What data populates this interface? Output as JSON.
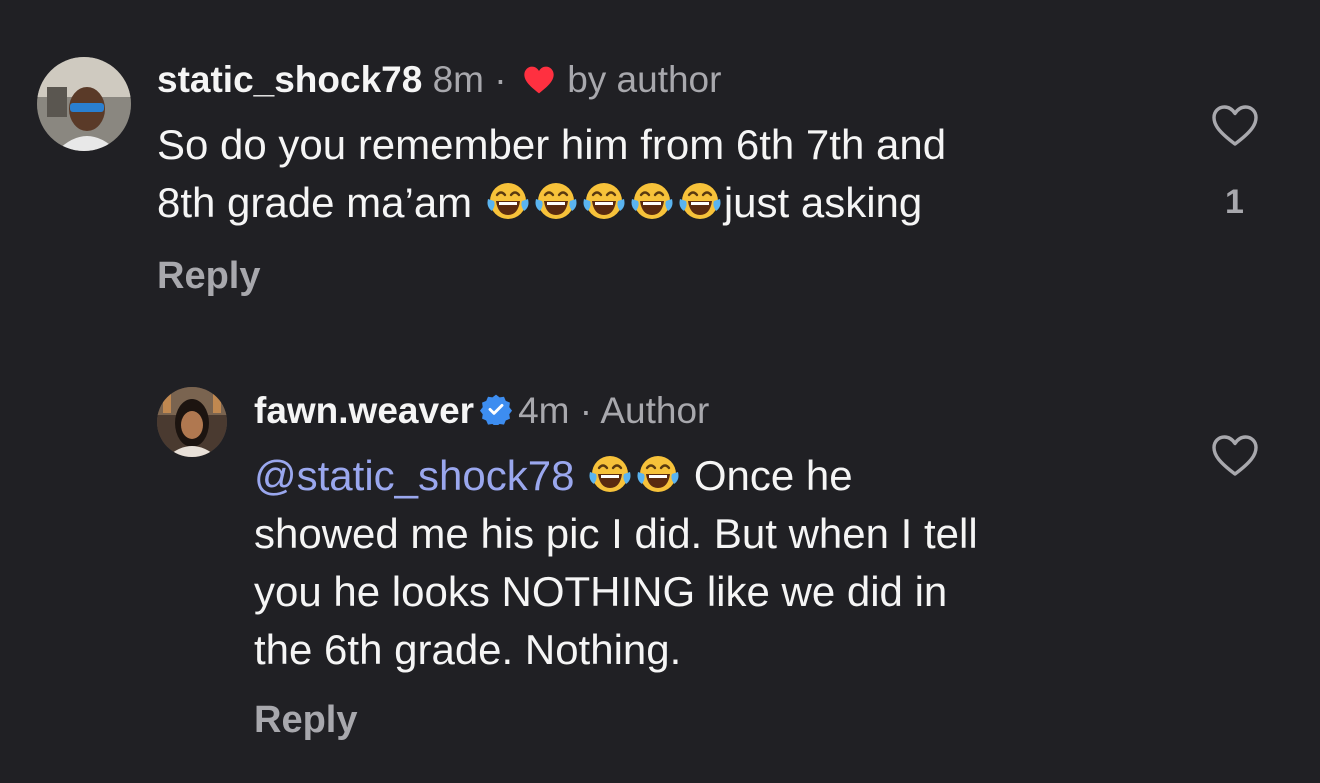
{
  "comments": [
    {
      "username": "static_shock78",
      "time": "8m",
      "separator": "·",
      "by_author": "by author",
      "text_1": "So do you remember him from 6th 7th and",
      "text_2a": "8th grade ma’am",
      "emoji_count": 5,
      "text_2b": "just asking",
      "reply_label": "Reply",
      "like_count": "1",
      "icons": [
        "avatar",
        "heart-filled-icon",
        "heart-outline-icon",
        "face-with-tears-of-joy-emoji"
      ]
    },
    {
      "username": "fawn.weaver",
      "time": "4m",
      "separator": "·",
      "author_label": "Author",
      "mention": "@static_shock78",
      "text_after_emoji": "Once he",
      "text_line_2": "showed me his pic I did. But when I tell",
      "text_line_3": "you he looks NOTHING like we did in",
      "text_line_4": "the 6th grade. Nothing.",
      "reply_label": "Reply",
      "icons": [
        "avatar",
        "verified-badge-icon",
        "heart-outline-icon",
        "face-with-tears-of-joy-emoji"
      ]
    }
  ],
  "colors": {
    "background": "#202024",
    "text_primary": "#f5f5f5",
    "text_secondary": "#a8a8ad",
    "mention": "#9aa7ee",
    "heart_red": "#ff3040",
    "verified_blue": "#3d8df0"
  }
}
